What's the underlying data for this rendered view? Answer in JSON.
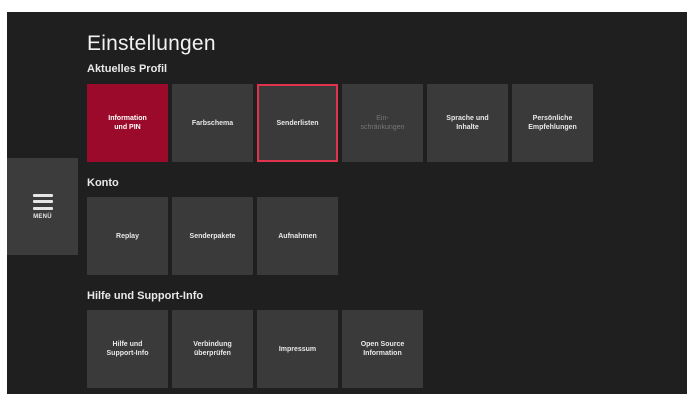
{
  "menu": {
    "label": "MENÜ",
    "icon": "hamburger-menu-icon"
  },
  "page_title": "Einstellungen",
  "sections": [
    {
      "title": "Aktuelles Profil",
      "tiles": [
        {
          "label": "Information\nund PIN",
          "state": "selected"
        },
        {
          "label": "Farbschema",
          "state": "normal"
        },
        {
          "label": "Senderlisten",
          "state": "focused"
        },
        {
          "label": "Ein-\nschränkungen",
          "state": "disabled"
        },
        {
          "label": "Sprache und\nInhalte",
          "state": "normal"
        },
        {
          "label": "Persönliche\nEmpfehlungen",
          "state": "normal"
        }
      ]
    },
    {
      "title": "Konto",
      "tiles": [
        {
          "label": "Replay",
          "state": "normal"
        },
        {
          "label": "Senderpakete",
          "state": "normal"
        },
        {
          "label": "Aufnahmen",
          "state": "normal"
        }
      ]
    },
    {
      "title": "Hilfe und Support-Info",
      "tiles": [
        {
          "label": "Hilfe und\nSupport-Info",
          "state": "normal"
        },
        {
          "label": "Verbindung\nüberprüfen",
          "state": "normal"
        },
        {
          "label": "Impressum",
          "state": "normal"
        },
        {
          "label": "Open Source\nInformation",
          "state": "normal"
        }
      ]
    }
  ],
  "colors": {
    "background": "#1f1f1f",
    "tile": "#3a3a3a",
    "selected": "#9b0a2b",
    "focus_border": "#e0344e"
  }
}
